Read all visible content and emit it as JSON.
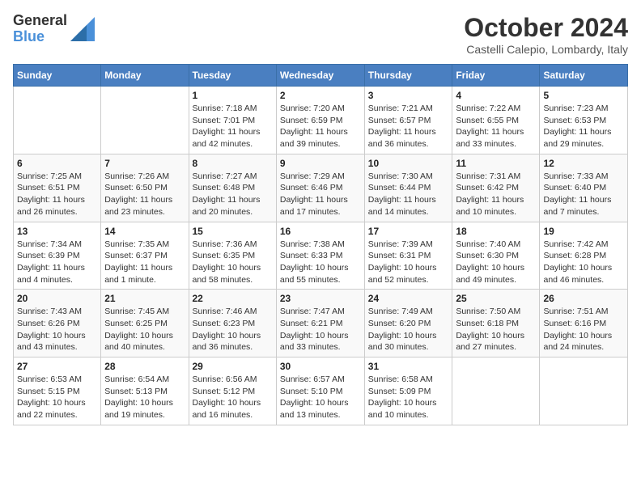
{
  "header": {
    "logo_general": "General",
    "logo_blue": "Blue",
    "month_title": "October 2024",
    "location": "Castelli Calepio, Lombardy, Italy"
  },
  "weekdays": [
    "Sunday",
    "Monday",
    "Tuesday",
    "Wednesday",
    "Thursday",
    "Friday",
    "Saturday"
  ],
  "weeks": [
    [
      {
        "day": "",
        "info": ""
      },
      {
        "day": "",
        "info": ""
      },
      {
        "day": "1",
        "info": "Sunrise: 7:18 AM\nSunset: 7:01 PM\nDaylight: 11 hours and 42 minutes."
      },
      {
        "day": "2",
        "info": "Sunrise: 7:20 AM\nSunset: 6:59 PM\nDaylight: 11 hours and 39 minutes."
      },
      {
        "day": "3",
        "info": "Sunrise: 7:21 AM\nSunset: 6:57 PM\nDaylight: 11 hours and 36 minutes."
      },
      {
        "day": "4",
        "info": "Sunrise: 7:22 AM\nSunset: 6:55 PM\nDaylight: 11 hours and 33 minutes."
      },
      {
        "day": "5",
        "info": "Sunrise: 7:23 AM\nSunset: 6:53 PM\nDaylight: 11 hours and 29 minutes."
      }
    ],
    [
      {
        "day": "6",
        "info": "Sunrise: 7:25 AM\nSunset: 6:51 PM\nDaylight: 11 hours and 26 minutes."
      },
      {
        "day": "7",
        "info": "Sunrise: 7:26 AM\nSunset: 6:50 PM\nDaylight: 11 hours and 23 minutes."
      },
      {
        "day": "8",
        "info": "Sunrise: 7:27 AM\nSunset: 6:48 PM\nDaylight: 11 hours and 20 minutes."
      },
      {
        "day": "9",
        "info": "Sunrise: 7:29 AM\nSunset: 6:46 PM\nDaylight: 11 hours and 17 minutes."
      },
      {
        "day": "10",
        "info": "Sunrise: 7:30 AM\nSunset: 6:44 PM\nDaylight: 11 hours and 14 minutes."
      },
      {
        "day": "11",
        "info": "Sunrise: 7:31 AM\nSunset: 6:42 PM\nDaylight: 11 hours and 10 minutes."
      },
      {
        "day": "12",
        "info": "Sunrise: 7:33 AM\nSunset: 6:40 PM\nDaylight: 11 hours and 7 minutes."
      }
    ],
    [
      {
        "day": "13",
        "info": "Sunrise: 7:34 AM\nSunset: 6:39 PM\nDaylight: 11 hours and 4 minutes."
      },
      {
        "day": "14",
        "info": "Sunrise: 7:35 AM\nSunset: 6:37 PM\nDaylight: 11 hours and 1 minute."
      },
      {
        "day": "15",
        "info": "Sunrise: 7:36 AM\nSunset: 6:35 PM\nDaylight: 10 hours and 58 minutes."
      },
      {
        "day": "16",
        "info": "Sunrise: 7:38 AM\nSunset: 6:33 PM\nDaylight: 10 hours and 55 minutes."
      },
      {
        "day": "17",
        "info": "Sunrise: 7:39 AM\nSunset: 6:31 PM\nDaylight: 10 hours and 52 minutes."
      },
      {
        "day": "18",
        "info": "Sunrise: 7:40 AM\nSunset: 6:30 PM\nDaylight: 10 hours and 49 minutes."
      },
      {
        "day": "19",
        "info": "Sunrise: 7:42 AM\nSunset: 6:28 PM\nDaylight: 10 hours and 46 minutes."
      }
    ],
    [
      {
        "day": "20",
        "info": "Sunrise: 7:43 AM\nSunset: 6:26 PM\nDaylight: 10 hours and 43 minutes."
      },
      {
        "day": "21",
        "info": "Sunrise: 7:45 AM\nSunset: 6:25 PM\nDaylight: 10 hours and 40 minutes."
      },
      {
        "day": "22",
        "info": "Sunrise: 7:46 AM\nSunset: 6:23 PM\nDaylight: 10 hours and 36 minutes."
      },
      {
        "day": "23",
        "info": "Sunrise: 7:47 AM\nSunset: 6:21 PM\nDaylight: 10 hours and 33 minutes."
      },
      {
        "day": "24",
        "info": "Sunrise: 7:49 AM\nSunset: 6:20 PM\nDaylight: 10 hours and 30 minutes."
      },
      {
        "day": "25",
        "info": "Sunrise: 7:50 AM\nSunset: 6:18 PM\nDaylight: 10 hours and 27 minutes."
      },
      {
        "day": "26",
        "info": "Sunrise: 7:51 AM\nSunset: 6:16 PM\nDaylight: 10 hours and 24 minutes."
      }
    ],
    [
      {
        "day": "27",
        "info": "Sunrise: 6:53 AM\nSunset: 5:15 PM\nDaylight: 10 hours and 22 minutes."
      },
      {
        "day": "28",
        "info": "Sunrise: 6:54 AM\nSunset: 5:13 PM\nDaylight: 10 hours and 19 minutes."
      },
      {
        "day": "29",
        "info": "Sunrise: 6:56 AM\nSunset: 5:12 PM\nDaylight: 10 hours and 16 minutes."
      },
      {
        "day": "30",
        "info": "Sunrise: 6:57 AM\nSunset: 5:10 PM\nDaylight: 10 hours and 13 minutes."
      },
      {
        "day": "31",
        "info": "Sunrise: 6:58 AM\nSunset: 5:09 PM\nDaylight: 10 hours and 10 minutes."
      },
      {
        "day": "",
        "info": ""
      },
      {
        "day": "",
        "info": ""
      }
    ]
  ]
}
